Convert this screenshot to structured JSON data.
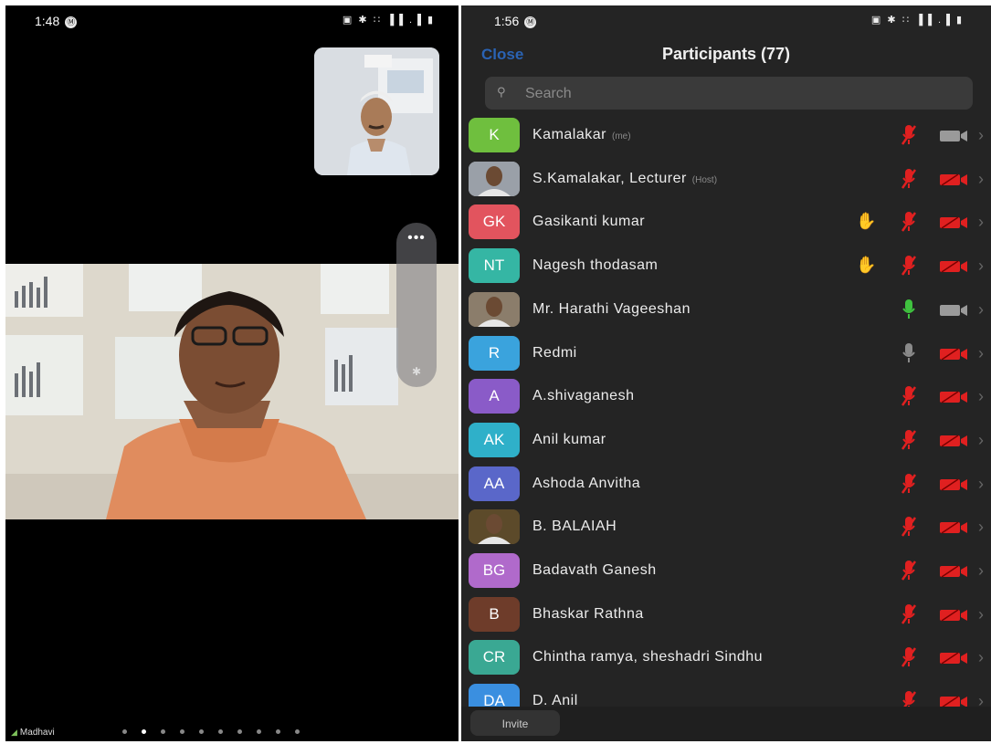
{
  "left": {
    "status_time": "1:48",
    "status_badge": "Ⓜ",
    "status_icons": "▣ ✱ ∶∶ ▐▐ .▐ ▮",
    "more_label": "•••",
    "bluetooth_label": "✱",
    "active_speaker": "Madhavi",
    "page_count": 10,
    "active_page": 2
  },
  "right": {
    "status_time": "1:56",
    "status_badge": "Ⓜ",
    "status_icons": "▣ ✱ ∶∶ ▐▐ .▐ ▮",
    "close_label": "Close",
    "title": "Participants (77)",
    "search_placeholder": "Search",
    "invite_label": "Invite",
    "participants": [
      {
        "initials": "K",
        "color": "#6fbf3e",
        "photo": false,
        "name": "Kamalakar",
        "tag": "(me)",
        "hand": false,
        "mic": "muted",
        "cam": "off-gray"
      },
      {
        "initials": "",
        "color": "#9aa0a8",
        "photo": true,
        "name": "S.Kamalakar, Lecturer",
        "tag": "(Host)",
        "hand": false,
        "mic": "muted",
        "cam": "off"
      },
      {
        "initials": "GK",
        "color": "#e2545e",
        "photo": false,
        "name": "Gasikanti kumar",
        "tag": "",
        "hand": true,
        "mic": "muted",
        "cam": "off"
      },
      {
        "initials": "NT",
        "color": "#35b6a4",
        "photo": false,
        "name": "Nagesh thodasam",
        "tag": "",
        "hand": true,
        "mic": "muted",
        "cam": "off"
      },
      {
        "initials": "",
        "color": "#8b7d6b",
        "photo": true,
        "name": "Mr. Harathi Vageeshan",
        "tag": "",
        "hand": false,
        "mic": "on",
        "cam": "on"
      },
      {
        "initials": "R",
        "color": "#3aa3dd",
        "photo": false,
        "name": "Redmi",
        "tag": "",
        "hand": false,
        "mic": "gray",
        "cam": "off"
      },
      {
        "initials": "A",
        "color": "#8a5bc8",
        "photo": false,
        "name": "A.shivaganesh",
        "tag": "",
        "hand": false,
        "mic": "muted",
        "cam": "off"
      },
      {
        "initials": "AK",
        "color": "#2fb0c9",
        "photo": false,
        "name": "Anil kumar",
        "tag": "",
        "hand": false,
        "mic": "muted",
        "cam": "off"
      },
      {
        "initials": "AA",
        "color": "#5a67c9",
        "photo": false,
        "name": "Ashoda Anvitha",
        "tag": "",
        "hand": false,
        "mic": "muted",
        "cam": "off"
      },
      {
        "initials": "",
        "color": "#5c4a2a",
        "photo": true,
        "name": "B. BALAIAH",
        "tag": "",
        "hand": false,
        "mic": "muted",
        "cam": "off"
      },
      {
        "initials": "BG",
        "color": "#b06acb",
        "photo": false,
        "name": "Badavath Ganesh",
        "tag": "",
        "hand": false,
        "mic": "muted",
        "cam": "off"
      },
      {
        "initials": "B",
        "color": "#6e3c2a",
        "photo": false,
        "name": "Bhaskar Rathna",
        "tag": "",
        "hand": false,
        "mic": "muted",
        "cam": "off"
      },
      {
        "initials": "CR",
        "color": "#3aa893",
        "photo": false,
        "name": "Chintha ramya, sheshadri Sindhu",
        "tag": "",
        "hand": false,
        "mic": "muted",
        "cam": "off"
      },
      {
        "initials": "DA",
        "color": "#3a8fe0",
        "photo": false,
        "name": "D. Anil",
        "tag": "",
        "hand": false,
        "mic": "muted",
        "cam": "off"
      }
    ]
  },
  "colors": {
    "muted_red": "#e02020",
    "mic_on_green": "#3fc23f",
    "hand_yellow": "#f2b705",
    "close_blue": "#2a63b4"
  }
}
